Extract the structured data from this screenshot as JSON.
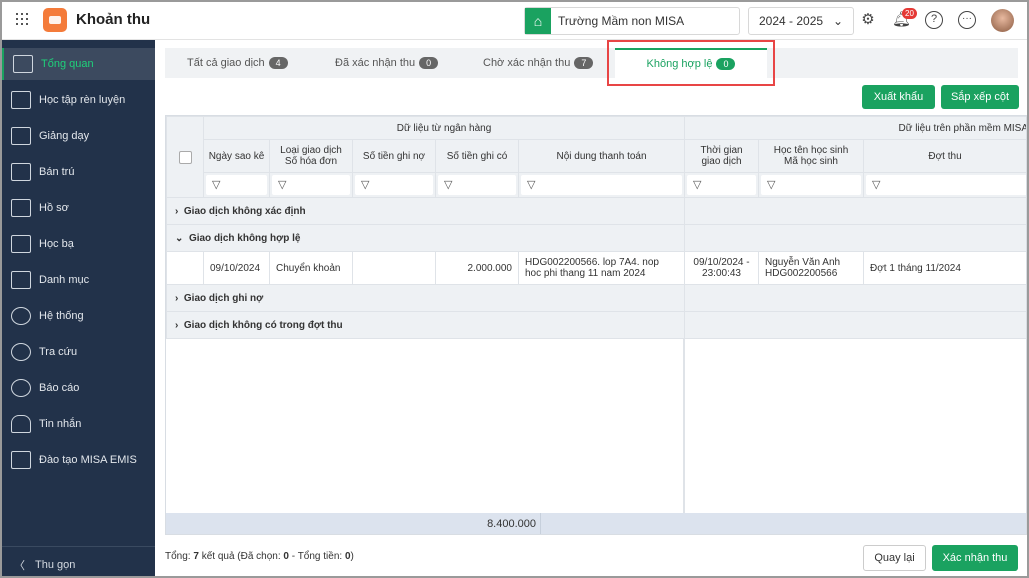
{
  "header": {
    "title": "Khoản thu",
    "school": "Trường Mầm non MISA",
    "year": "2024 - 2025",
    "notifications": "20"
  },
  "sidebar": {
    "items": [
      {
        "label": "Tổng quan"
      },
      {
        "label": "Học tập rèn luyện"
      },
      {
        "label": "Giảng dạy"
      },
      {
        "label": "Bán trú"
      },
      {
        "label": "Hồ sơ"
      },
      {
        "label": "Học bạ"
      },
      {
        "label": "Danh mục"
      },
      {
        "label": "Hệ thống"
      },
      {
        "label": "Tra cứu"
      },
      {
        "label": "Báo cáo"
      },
      {
        "label": "Tin nhắn"
      },
      {
        "label": "Đào tạo MISA EMIS"
      }
    ],
    "collapse": "Thu gọn"
  },
  "tabs": [
    {
      "label": "Tất cả giao dịch",
      "count": "4"
    },
    {
      "label": "Đã xác nhận thu",
      "count": "0"
    },
    {
      "label": "Chờ xác nhận thu",
      "count": "7"
    },
    {
      "label": "Không hợp lệ",
      "count": "0"
    }
  ],
  "toolbar": {
    "export": "Xuất khẩu",
    "sort_columns": "Sắp xếp cột"
  },
  "table": {
    "group_bank": "Dữ liệu từ ngân hàng",
    "group_misa": "Dữ liệu trên phần mềm MISA",
    "columns": {
      "date": "Ngày sao kê",
      "type1": "Loại giao dịch",
      "type2": "Số hóa đơn",
      "debit": "Số tiền ghi nợ",
      "credit": "Số tiền ghi có",
      "content": "Nội dung thanh toán",
      "time1": "Thời gian",
      "time2": "giao dịch",
      "student1": "Học tên học sinh",
      "student2": "Mã học sinh",
      "period": "Đợt thu"
    },
    "groups": [
      "Giao dịch không xác định",
      "Giao dịch không hợp lệ",
      "Giao dịch ghi nợ",
      "Giao dịch không có trong đợt thu"
    ],
    "row": {
      "date": "09/10/2024",
      "type": "Chuyển khoản",
      "debit": "",
      "credit": "2.000.000",
      "content1": "HDG002200566. lop 7A4. nop",
      "content2": "hoc phi thang 11 nam 2024",
      "time1": "09/10/2024 -",
      "time2": "23:00:43",
      "student1": "Nguyễn Văn Anh",
      "student2": "HDG002200566",
      "period": "Đợt 1 tháng 11/2024"
    },
    "total": "8.400.000"
  },
  "footer": {
    "prefix": "Tổng: ",
    "count": "7",
    "mid": " kết quả (Đã chọn: ",
    "selected": "0",
    "mid2": " - Tổng tiền: ",
    "amount": "0",
    "end": ")",
    "back": "Quay lại",
    "confirm": "Xác nhận thu"
  }
}
